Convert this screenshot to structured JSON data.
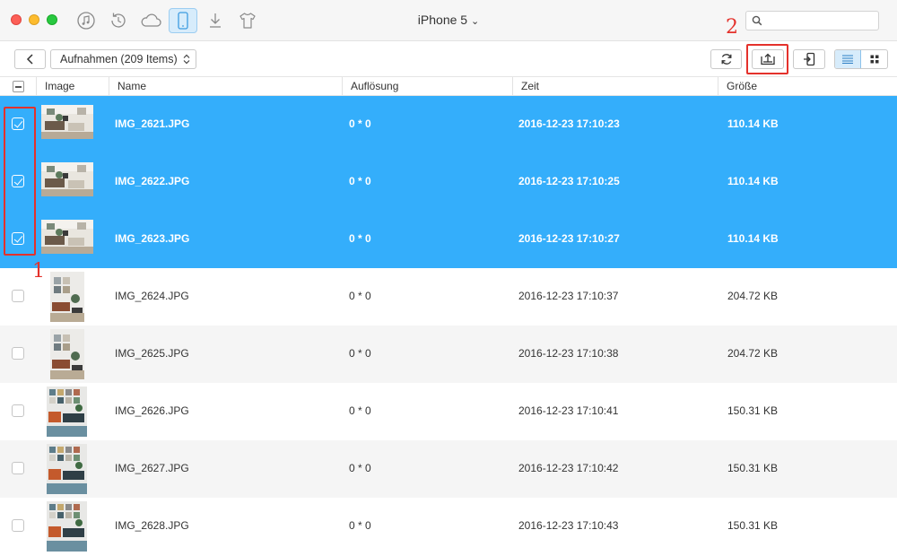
{
  "window": {
    "device_name": "iPhone 5",
    "device_chevron": "⌄"
  },
  "search": {
    "value": "",
    "placeholder": ""
  },
  "toolbar": {
    "album_label": "Aufnahmen (209 Items)",
    "album_arrows": "▴▾"
  },
  "table": {
    "headers": {
      "image": "Image",
      "name": "Name",
      "resolution": "Auflösung",
      "time": "Zeit",
      "size": "Größe"
    },
    "rows": [
      {
        "name": "IMG_2621.JPG",
        "resolution": "0 * 0",
        "time": "2016-12-23 17:10:23",
        "size": "110.14 KB",
        "selected": true,
        "orientation": "landscape"
      },
      {
        "name": "IMG_2622.JPG",
        "resolution": "0 * 0",
        "time": "2016-12-23 17:10:25",
        "size": "110.14 KB",
        "selected": true,
        "orientation": "landscape"
      },
      {
        "name": "IMG_2623.JPG",
        "resolution": "0 * 0",
        "time": "2016-12-23 17:10:27",
        "size": "110.14 KB",
        "selected": true,
        "orientation": "landscape"
      },
      {
        "name": "IMG_2624.JPG",
        "resolution": "0 * 0",
        "time": "2016-12-23 17:10:37",
        "size": "204.72 KB",
        "selected": false,
        "orientation": "portrait"
      },
      {
        "name": "IMG_2625.JPG",
        "resolution": "0 * 0",
        "time": "2016-12-23 17:10:38",
        "size": "204.72 KB",
        "selected": false,
        "orientation": "portrait"
      },
      {
        "name": "IMG_2626.JPG",
        "resolution": "0 * 0",
        "time": "2016-12-23 17:10:41",
        "size": "150.31 KB",
        "selected": false,
        "orientation": "portrait"
      },
      {
        "name": "IMG_2627.JPG",
        "resolution": "0 * 0",
        "time": "2016-12-23 17:10:42",
        "size": "150.31 KB",
        "selected": false,
        "orientation": "portrait"
      },
      {
        "name": "IMG_2628.JPG",
        "resolution": "0 * 0",
        "time": "2016-12-23 17:10:43",
        "size": "150.31 KB",
        "selected": false,
        "orientation": "portrait"
      }
    ]
  },
  "annotations": {
    "step1": "1",
    "step2": "2"
  },
  "colors": {
    "selection": "#34aefb",
    "annotation": "#e4312b",
    "active_tab": "#d7ecfb"
  },
  "icons": {
    "titlebar": [
      "music-icon",
      "history-icon",
      "cloud-icon",
      "phone-icon",
      "download-icon",
      "shirt-icon"
    ],
    "toolbar": [
      "back-icon",
      "refresh-icon",
      "export-to-computer-icon",
      "send-to-device-icon",
      "list-view-icon",
      "grid-view-icon"
    ]
  }
}
